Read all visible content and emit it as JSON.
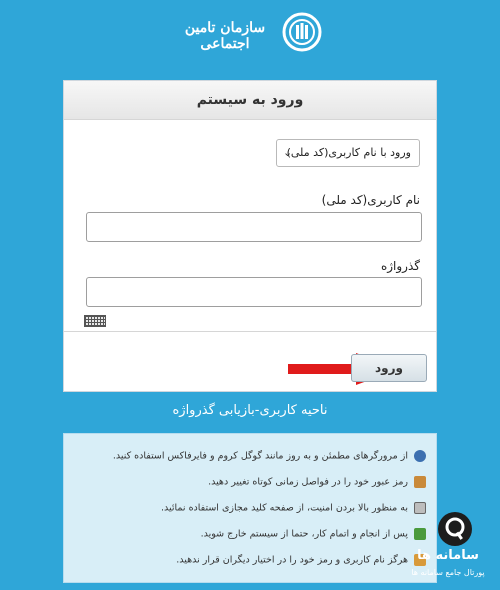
{
  "header": {
    "org_name": "سازمان تامین اجتماعی"
  },
  "login": {
    "title": "ورود به سیستم",
    "method_selected": "ورود با نام کاربری(کد ملی)",
    "username_label": "نام کاربری(کد ملی)",
    "password_label": "گذرواژه",
    "username_value": "",
    "password_value": "",
    "submit_label": "ورود"
  },
  "recovery_link": "ناحیه کاربری-بازیابی گذرواژه",
  "tips": [
    {
      "icon": "browser-icon",
      "text": "از مرورگرهای مطمئن و به روز مانند گوگل کروم و فایرفاکس استفاده کنید."
    },
    {
      "icon": "password-change-icon",
      "text": "رمز عبور خود را در فواصل زمانی کوتاه تغییر دهید."
    },
    {
      "icon": "keyboard-icon",
      "text": "به منظور بالا بردن امنیت، از صفحه کلید مجازی استفاده نمائید."
    },
    {
      "icon": "logout-icon",
      "text": "پس از انجام و اتمام کار، حتما از سیستم خارج شوید."
    },
    {
      "icon": "privacy-icon",
      "text": "هرگز نام کاربری و رمز خود را در اختیار دیگران قرار ندهید."
    }
  ],
  "watermark": {
    "title": "سامانه ها",
    "subtitle": "پورتال جامع سامانه ها"
  },
  "colors": {
    "background": "#2fa6d8",
    "arrow": "#e01b1b",
    "tips_bg": "#d8eef7"
  }
}
